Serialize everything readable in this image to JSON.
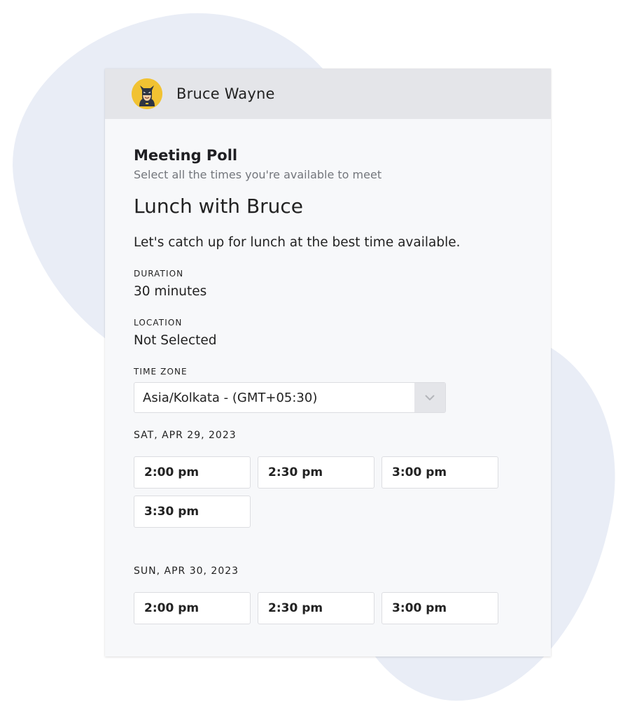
{
  "host": {
    "name": "Bruce Wayne",
    "avatar_icon": "batman-avatar-icon"
  },
  "poll": {
    "title": "Meeting Poll",
    "subtitle": "Select all the times you're available to meet"
  },
  "event": {
    "title": "Lunch with Bruce",
    "description": "Let's catch up for lunch at the best time available."
  },
  "duration": {
    "label": "DURATION",
    "value": "30 minutes"
  },
  "location": {
    "label": "LOCATION",
    "value": "Not Selected"
  },
  "timezone": {
    "label": "TIME ZONE",
    "value": "Asia/Kolkata - (GMT+05:30)"
  },
  "days": [
    {
      "date": "SAT, APR 29, 2023",
      "slots": [
        "2:00 pm",
        "2:30 pm",
        "3:00 pm",
        "3:30 pm"
      ]
    },
    {
      "date": "SUN, APR 30, 2023",
      "slots": [
        "2:00 pm",
        "2:30 pm",
        "3:00 pm"
      ]
    }
  ],
  "colors": {
    "header_bg": "#e4e5e9",
    "card_bg": "#f7f8fa",
    "blob": "#e9edf6",
    "avatar_bg": "#f1c232"
  }
}
